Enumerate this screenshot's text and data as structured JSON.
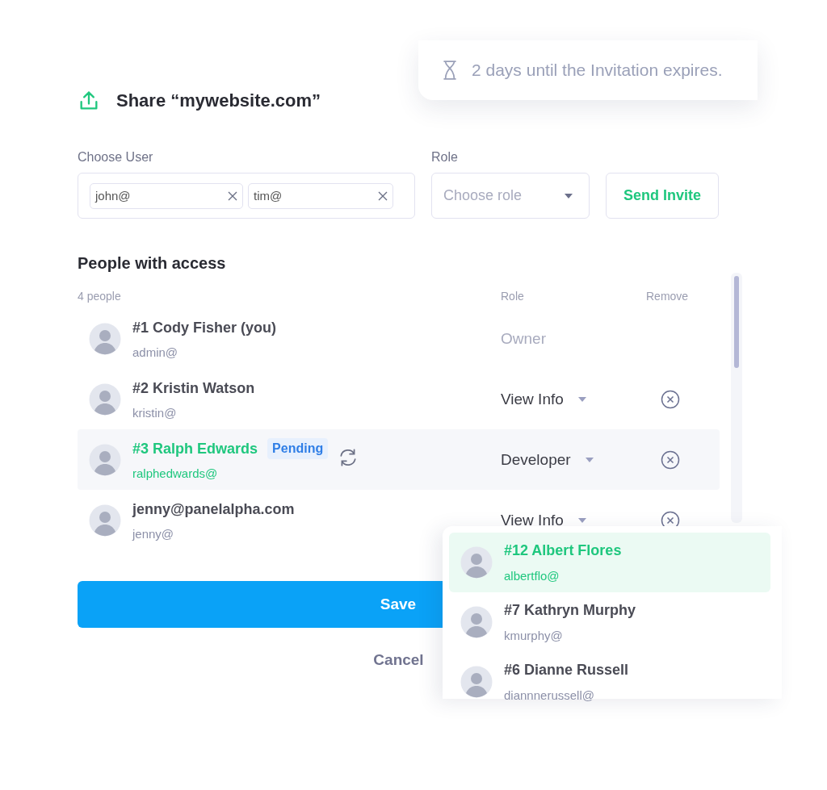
{
  "toast": {
    "text": "2 days until the Invitation expires."
  },
  "title": "Share “mywebsite.com”",
  "invite": {
    "user_label": "Choose User",
    "chips": [
      {
        "text": "john@"
      },
      {
        "text": "tim@"
      }
    ],
    "role_label": "Role",
    "role_placeholder": "Choose role",
    "send_button": "Send Invite"
  },
  "people": {
    "heading": "People with access",
    "count": "4 people",
    "role_header": "Role",
    "remove_header": "Remove",
    "rows": [
      {
        "kind": "owner",
        "name": "#1 Cody Fisher (you)",
        "email": "admin@",
        "role": "Owner",
        "selected": false
      },
      {
        "kind": "member",
        "name": "#2 Kristin Watson",
        "email": "kristin@",
        "role": "View Info",
        "selected": false
      },
      {
        "kind": "pending",
        "name": "#3 Ralph Edwards",
        "email": "ralphedwards@",
        "badge": "Pending",
        "role": "Developer",
        "selected": true
      },
      {
        "kind": "member",
        "name": "jenny@panelalpha.com",
        "email": "jenny@",
        "role": "View Info",
        "selected": false
      }
    ]
  },
  "save_button": "Save",
  "cancel_button": "Cancel",
  "suggestions": [
    {
      "name": "#12 Albert Flores",
      "email": "albertflo@",
      "selected": true
    },
    {
      "name": "#7 Kathryn Murphy",
      "email": "kmurphy@",
      "selected": false
    },
    {
      "name": "#6 Dianne Russell",
      "email": "diannnerussell@",
      "selected": false
    }
  ]
}
